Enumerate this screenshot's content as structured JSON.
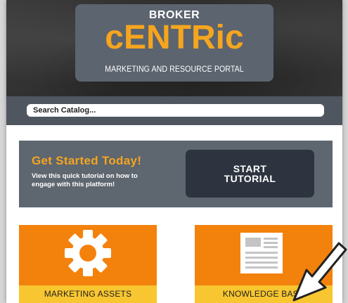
{
  "header": {
    "logo_top": "BROKER",
    "logo_main": "cENTRic",
    "logo_sub": "MARKETING AND RESOURCE PORTAL"
  },
  "search": {
    "placeholder": "Search Catalog..."
  },
  "banner": {
    "title": "Get Started Today!",
    "description_line1": "View this quick tutorial on how to",
    "description_line2": "engage with this platform!",
    "button_line1": "START",
    "button_line2": "TUTORIAL"
  },
  "tiles": [
    {
      "label": "MARKETING ASSETS",
      "icon": "gear-icon"
    },
    {
      "label": "KNOWLEDGE BASE",
      "icon": "document-icon"
    }
  ],
  "colors": {
    "accent_orange": "#f3820d",
    "accent_yellow": "#f8c630",
    "logo_orange": "#f5a51e",
    "panel_gray": "#5e6670",
    "button_dark": "#2d3440"
  }
}
